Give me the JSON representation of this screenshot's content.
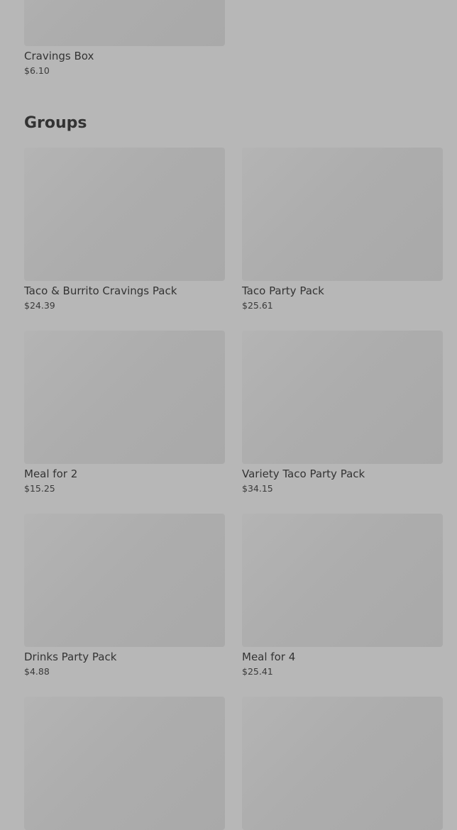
{
  "top_item": {
    "name": "Cravings Box",
    "price": "$6.10"
  },
  "groups": {
    "title": "Groups",
    "items": [
      {
        "name": "Taco & Burrito Cravings Pack",
        "price": "$24.39"
      },
      {
        "name": "Taco Party Pack",
        "price": "$25.61"
      },
      {
        "name": "Meal for 2",
        "price": "$15.25"
      },
      {
        "name": "Variety Taco Party Pack",
        "price": "$34.15"
      },
      {
        "name": "Drinks Party Pack",
        "price": "$4.88"
      },
      {
        "name": "Meal for 4",
        "price": "$25.41"
      }
    ]
  }
}
